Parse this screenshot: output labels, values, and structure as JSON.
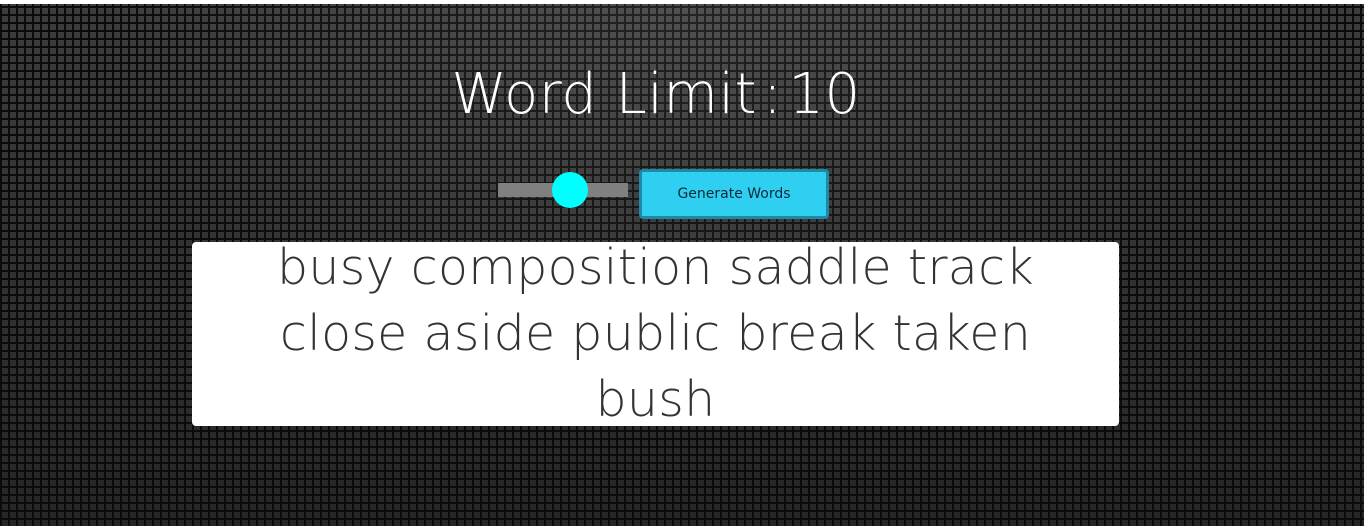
{
  "header": {
    "label": "Word Limit",
    "separator": ":",
    "value": "10"
  },
  "slider": {
    "fraction": 0.5
  },
  "generate_button": {
    "label": "Generate Words"
  },
  "output": {
    "text": "busy composition saddle track close aside public break taken bush"
  },
  "colors": {
    "slider_thumb": "#00ffff",
    "slider_track": "#808080",
    "button_fill": "#2fcff2",
    "button_border": "#1d89a6",
    "output_background": "#ffffff",
    "title_text": "#ffffff"
  }
}
